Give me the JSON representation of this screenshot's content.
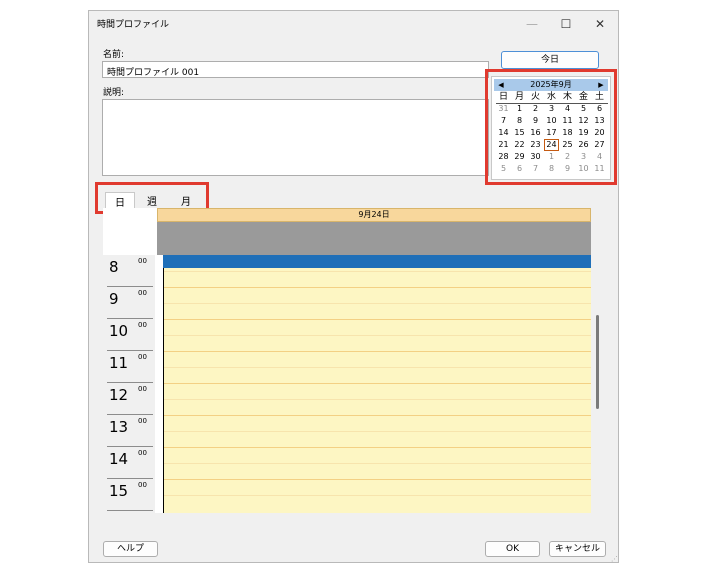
{
  "window": {
    "title": "時間プロファイル",
    "minimize": "—",
    "maximize": "☐",
    "close": "✕"
  },
  "form": {
    "name_label": "名前:",
    "name_value": "時間プロファイル 001",
    "description_label": "説明:",
    "description_value": ""
  },
  "today_button": "今日",
  "calendar": {
    "title": "2025年9月",
    "prev": "◀",
    "next": "▶",
    "weekdays": [
      "日",
      "月",
      "火",
      "水",
      "木",
      "金",
      "土"
    ],
    "weeks": [
      [
        "31",
        "1",
        "2",
        "3",
        "4",
        "5",
        "6"
      ],
      [
        "7",
        "8",
        "9",
        "10",
        "11",
        "12",
        "13"
      ],
      [
        "14",
        "15",
        "16",
        "17",
        "18",
        "19",
        "20"
      ],
      [
        "21",
        "22",
        "23",
        "24",
        "25",
        "26",
        "27"
      ],
      [
        "28",
        "29",
        "30",
        "1",
        "2",
        "3",
        "4"
      ],
      [
        "5",
        "6",
        "7",
        "8",
        "9",
        "10",
        "11"
      ]
    ],
    "today": "24"
  },
  "view_tabs": [
    "日",
    "週",
    "月"
  ],
  "schedule": {
    "day_header": "9月24日",
    "hours": [
      "8",
      "9",
      "10",
      "11",
      "12",
      "13",
      "14",
      "15"
    ],
    "minute_label": "00"
  },
  "buttons": {
    "help": "ヘルプ",
    "ok": "OK",
    "cancel": "キャンセル"
  }
}
